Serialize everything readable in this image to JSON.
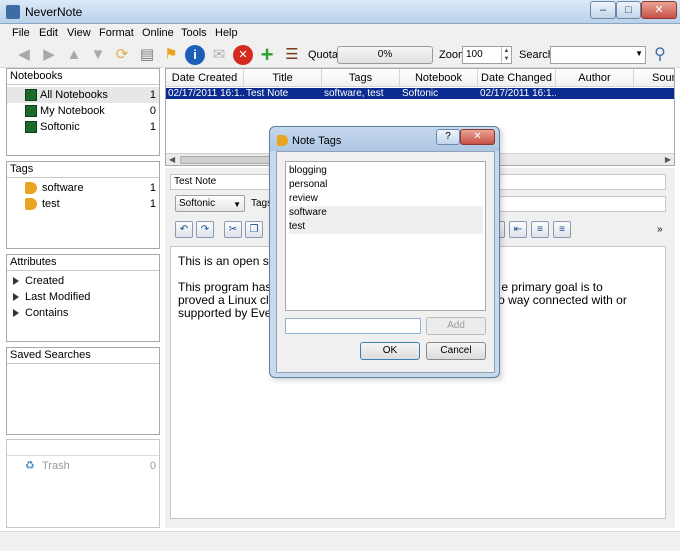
{
  "window": {
    "title": "NeverNote"
  },
  "menu": [
    "File",
    "Edit",
    "View",
    "Format",
    "Online",
    "Tools",
    "Help"
  ],
  "toolbar": {
    "quota_label": "Quota:",
    "quota_value": "0%",
    "zoom_label": "Zoom",
    "zoom_value": "100",
    "search_label": "Search:",
    "search_value": ""
  },
  "notebooks": {
    "header": "Notebooks",
    "items": [
      {
        "label": "All Notebooks",
        "count": "1"
      },
      {
        "label": "My Notebook",
        "count": "0"
      },
      {
        "label": "Softonic",
        "count": "1"
      }
    ]
  },
  "tags": {
    "header": "Tags",
    "items": [
      {
        "label": "software",
        "count": "1"
      },
      {
        "label": "test",
        "count": "1"
      }
    ]
  },
  "attributes": {
    "header": "Attributes",
    "items": [
      "Created",
      "Last Modified",
      "Contains"
    ]
  },
  "saved_searches": {
    "header": "Saved Searches"
  },
  "trash": {
    "label": "Trash",
    "count": "0"
  },
  "note_table": {
    "columns": [
      "Date Created",
      "Title",
      "Tags",
      "Notebook",
      "Date Changed",
      "Author",
      "Sour"
    ],
    "rows": [
      {
        "date_created": "02/17/2011 16:1...",
        "title": "Test Note",
        "tags": "software, test",
        "notebook": "Softonic",
        "date_changed": "02/17/2011 16:1...",
        "author": "",
        "source": ""
      }
    ]
  },
  "editor": {
    "title": "Test Note",
    "notebook": "Softonic",
    "tags_label": "Tags",
    "paragraphs": [
      "This is an open so",
      "This program has t                                                                   e primary goal is to proved a Linux client.  While                                                   o way connected with or supported by Evern"
    ],
    "more": "»"
  },
  "dialog": {
    "title": "Note Tags",
    "help": "?",
    "close": "✕",
    "tags": [
      "blogging",
      "personal",
      "review",
      "software",
      "test"
    ],
    "add_input": "",
    "add_label": "Add",
    "ok_label": "OK",
    "cancel_label": "Cancel"
  }
}
